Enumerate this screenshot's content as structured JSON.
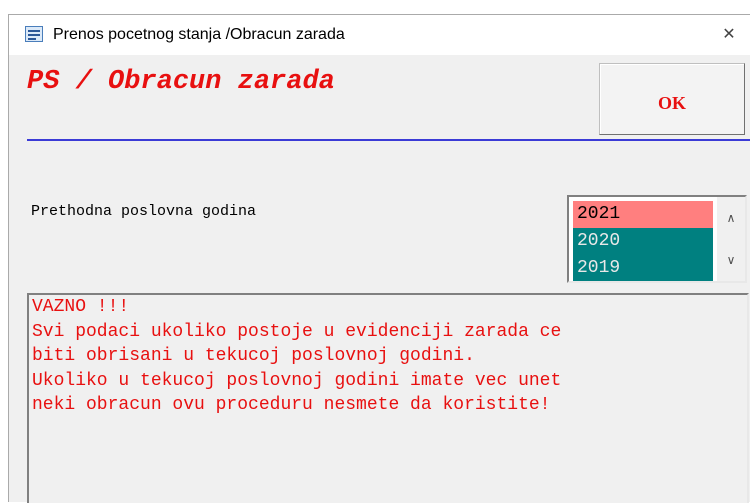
{
  "window": {
    "title": "Prenos pocetnog stanja /Obracun zarada",
    "close_glyph": "✕",
    "icon": "form-icon"
  },
  "header": {
    "title": "PS / Obracun zarada",
    "ok_label": "OK"
  },
  "year_field": {
    "label": "Prethodna poslovna godina",
    "options": [
      "2021",
      "2020",
      "2019"
    ],
    "selected": "2021",
    "scroll_up_glyph": "∧",
    "scroll_down_glyph": "∨"
  },
  "notice": {
    "lines": [
      "VAZNO !!!",
      "Svi podaci ukoliko postoje u evidenciji zarada ce",
      "biti obrisani u tekucoj poslovnoj godini.",
      "Ukoliko u tekucoj poslovnoj godini imate vec unet",
      "neki obracun ovu proceduru nesmete da koristite!"
    ]
  },
  "colors": {
    "accent_red": "#e81010",
    "selected_bg": "#ff7f7f",
    "list_bg": "#008080",
    "divider": "#3b3bd6"
  }
}
